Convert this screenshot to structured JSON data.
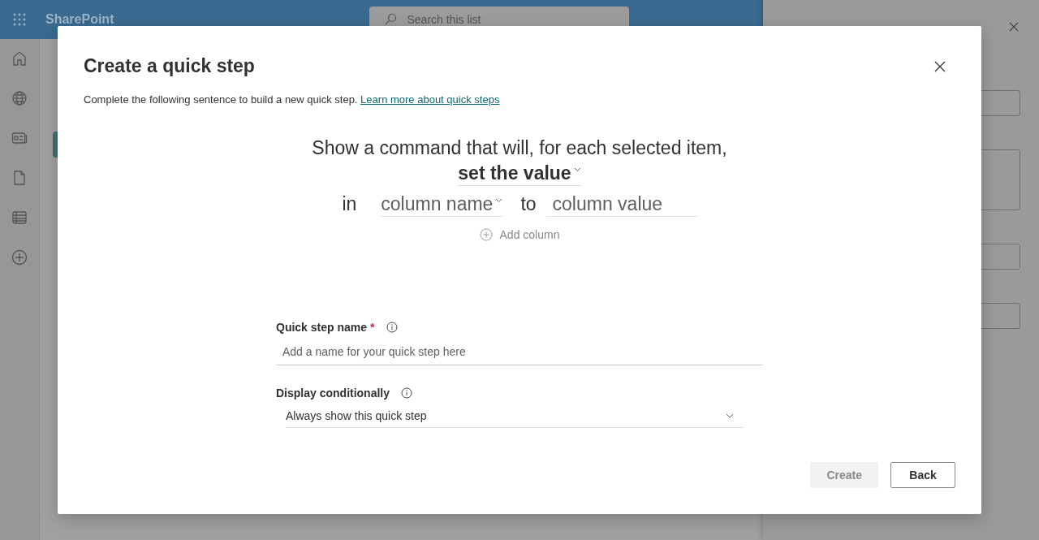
{
  "app_bar": {
    "title": "SharePoint",
    "search_placeholder": "Search this list"
  },
  "dialog": {
    "title": "Create a quick step",
    "description": "Complete the following sentence to build a new quick step.",
    "learn_link": "Learn more about quick steps",
    "sentence": {
      "intro": "Show a command that will, for each selected item,",
      "action": "set the value",
      "in": "in",
      "column_placeholder": "column name",
      "to": "to",
      "value_placeholder": "column value",
      "add_column": "Add column"
    },
    "required_mark": "*",
    "fields": [
      {
        "kind": "text",
        "label": "Quick step name",
        "required": true,
        "placeholder": "Add a name for your quick step here"
      },
      {
        "kind": "dropdown",
        "label": "Display conditionally",
        "required": false,
        "value": "Always show this quick step"
      }
    ],
    "buttons": [
      {
        "label": "Create",
        "kind": "primary",
        "disabled": true
      },
      {
        "label": "Back",
        "kind": "default",
        "disabled": false
      }
    ]
  }
}
